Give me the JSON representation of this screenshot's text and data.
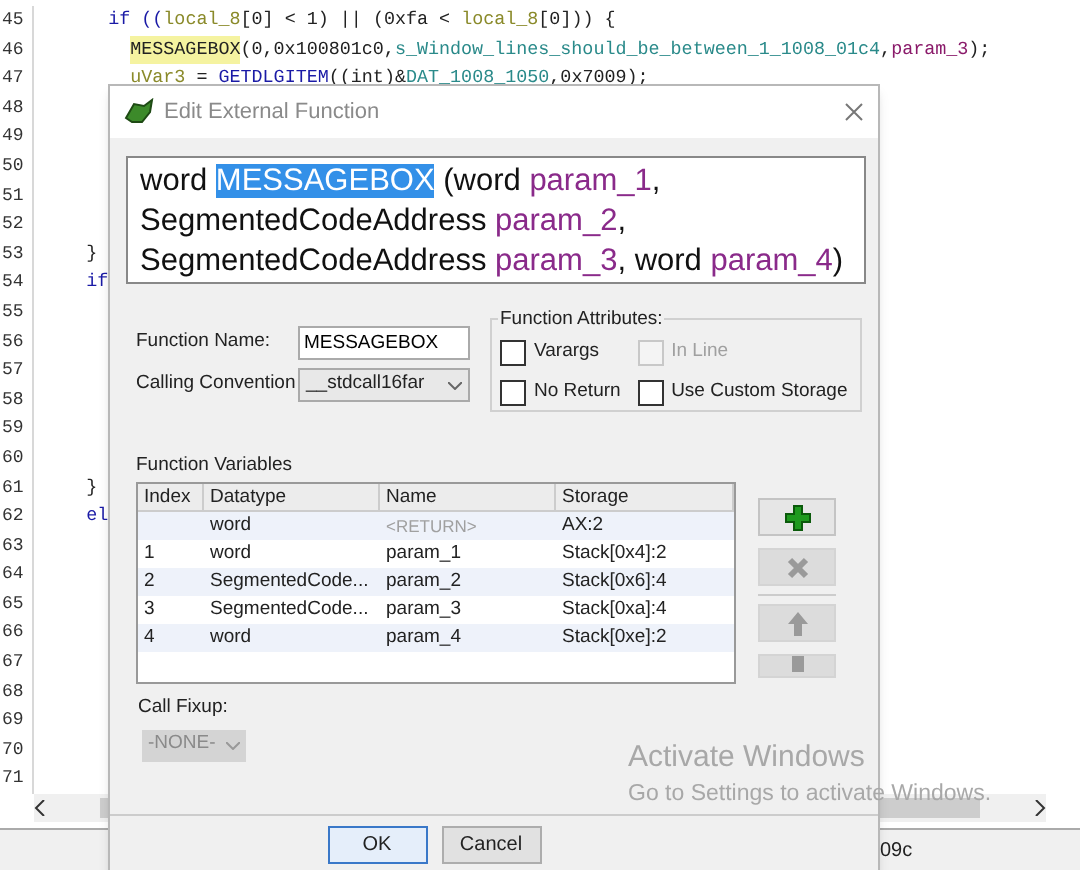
{
  "editor": {
    "lines": [
      {
        "number": "45",
        "tokens": [
          {
            "text": "      if ((",
            "kind": "keyword"
          },
          {
            "text": "local_8",
            "kind": "variable"
          },
          {
            "text": "[0] < 1) || (0xfa < ",
            "kind": "plain"
          },
          {
            "text": "local_8",
            "kind": "variable"
          },
          {
            "text": "[0])) {",
            "kind": "plain"
          }
        ]
      },
      {
        "number": "46",
        "tokens": [
          {
            "text": "        MESSAGEBOX",
            "kind": "highlight"
          },
          {
            "text": "(0,0x100801c0,",
            "kind": "plain"
          },
          {
            "text": "s_Window_lines_should_be_between_1_1008_01c4",
            "kind": "string"
          },
          {
            "text": ",",
            "kind": "plain"
          },
          {
            "text": "param_3",
            "kind": "param"
          },
          {
            "text": ");",
            "kind": "plain"
          }
        ]
      },
      {
        "number": "47",
        "tokens": [
          {
            "text": "        uVar3",
            "kind": "variable"
          },
          {
            "text": " = ",
            "kind": "plain"
          },
          {
            "text": "GETDLGITEM",
            "kind": "function"
          },
          {
            "text": "((int)&",
            "kind": "plain"
          },
          {
            "text": "DAT_1008_1050",
            "kind": "string"
          },
          {
            "text": ",0x7009);",
            "kind": "plain"
          }
        ]
      },
      {
        "number": "48"
      },
      {
        "number": "49"
      },
      {
        "number": "50"
      },
      {
        "number": "51"
      },
      {
        "number": "52"
      },
      {
        "number": "53",
        "tokens": [
          {
            "text": "    }",
            "kind": "plain"
          }
        ]
      },
      {
        "number": "54",
        "tokens": [
          {
            "text": "    if",
            "kind": "keyword"
          }
        ]
      },
      {
        "number": "55"
      },
      {
        "number": "56"
      },
      {
        "number": "57"
      },
      {
        "number": "58"
      },
      {
        "number": "59"
      },
      {
        "number": "60"
      },
      {
        "number": "61",
        "tokens": [
          {
            "text": "    }",
            "kind": "plain"
          }
        ]
      },
      {
        "number": "62",
        "tokens": [
          {
            "text": "    el",
            "kind": "keyword"
          }
        ]
      },
      {
        "number": "63"
      },
      {
        "number": "64"
      },
      {
        "number": "65"
      },
      {
        "number": "66"
      },
      {
        "number": "67"
      },
      {
        "number": "68"
      },
      {
        "number": "69"
      },
      {
        "number": "70"
      },
      {
        "number": "71"
      }
    ]
  },
  "status_bar": {
    "text": "09c"
  },
  "dialog": {
    "title": "Edit External Function",
    "signature": [
      [
        {
          "text": "word ",
          "kind": "type"
        },
        {
          "text": "MESSAGEBOX",
          "kind": "name",
          "selected": true
        },
        {
          "text": " (word ",
          "kind": "type"
        },
        {
          "text": "param_1",
          "kind": "param"
        },
        {
          "text": ",",
          "kind": "type"
        }
      ],
      [
        {
          "text": "SegmentedCodeAddress ",
          "kind": "type"
        },
        {
          "text": "param_2",
          "kind": "param"
        },
        {
          "text": ",",
          "kind": "type"
        }
      ],
      [
        {
          "text": "SegmentedCodeAddress ",
          "kind": "type"
        },
        {
          "text": "param_3",
          "kind": "param"
        },
        {
          "text": ", word ",
          "kind": "type"
        },
        {
          "text": "param_4",
          "kind": "param"
        },
        {
          "text": ")",
          "kind": "type"
        }
      ]
    ],
    "function_name": {
      "label": "Function Name:",
      "value": "MESSAGEBOX"
    },
    "calling_convention": {
      "label": "Calling Convention",
      "value": "__stdcall16far"
    },
    "function_attributes": {
      "title": "Function Attributes:",
      "options": [
        {
          "label": "Varargs",
          "checked": false,
          "disabled": false
        },
        {
          "label": "In Line",
          "checked": false,
          "disabled": true
        },
        {
          "label": "No Return",
          "checked": false,
          "disabled": false
        },
        {
          "label": "Use Custom Storage",
          "checked": false,
          "disabled": false
        }
      ]
    },
    "function_variables": {
      "title": "Function Variables",
      "columns": [
        "Index",
        "Datatype",
        "Name",
        "Storage"
      ],
      "rows": [
        {
          "kind": "return",
          "cells": [
            null,
            "word",
            "<RETURN>",
            "AX:2"
          ]
        },
        {
          "kind": "param",
          "cells": [
            "1",
            "word",
            "param_1",
            "Stack[0x4]:2"
          ]
        },
        {
          "kind": "param",
          "cells": [
            "2",
            "SegmentedCode...",
            "param_2",
            "Stack[0x6]:4"
          ]
        },
        {
          "kind": "param",
          "cells": [
            "3",
            "SegmentedCode...",
            "param_3",
            "Stack[0xa]:4"
          ]
        },
        {
          "kind": "param",
          "cells": [
            "4",
            "word",
            "param_4",
            "Stack[0xe]:2"
          ]
        }
      ],
      "buttons": [
        {
          "kind": "add",
          "disabled": false
        },
        {
          "kind": "delete",
          "disabled": true
        },
        {
          "kind": "up",
          "disabled": true
        },
        {
          "kind": "down",
          "disabled": true
        }
      ]
    },
    "call_fixup": {
      "label": "Call Fixup:",
      "value": "-NONE-",
      "disabled": true
    },
    "buttons": [
      {
        "label": "OK",
        "selected": true
      },
      {
        "label": "Cancel",
        "selected": false
      }
    ]
  },
  "os_notice": {
    "title": "Activate Windows",
    "text": "Go to Settings to activate Windows."
  }
}
